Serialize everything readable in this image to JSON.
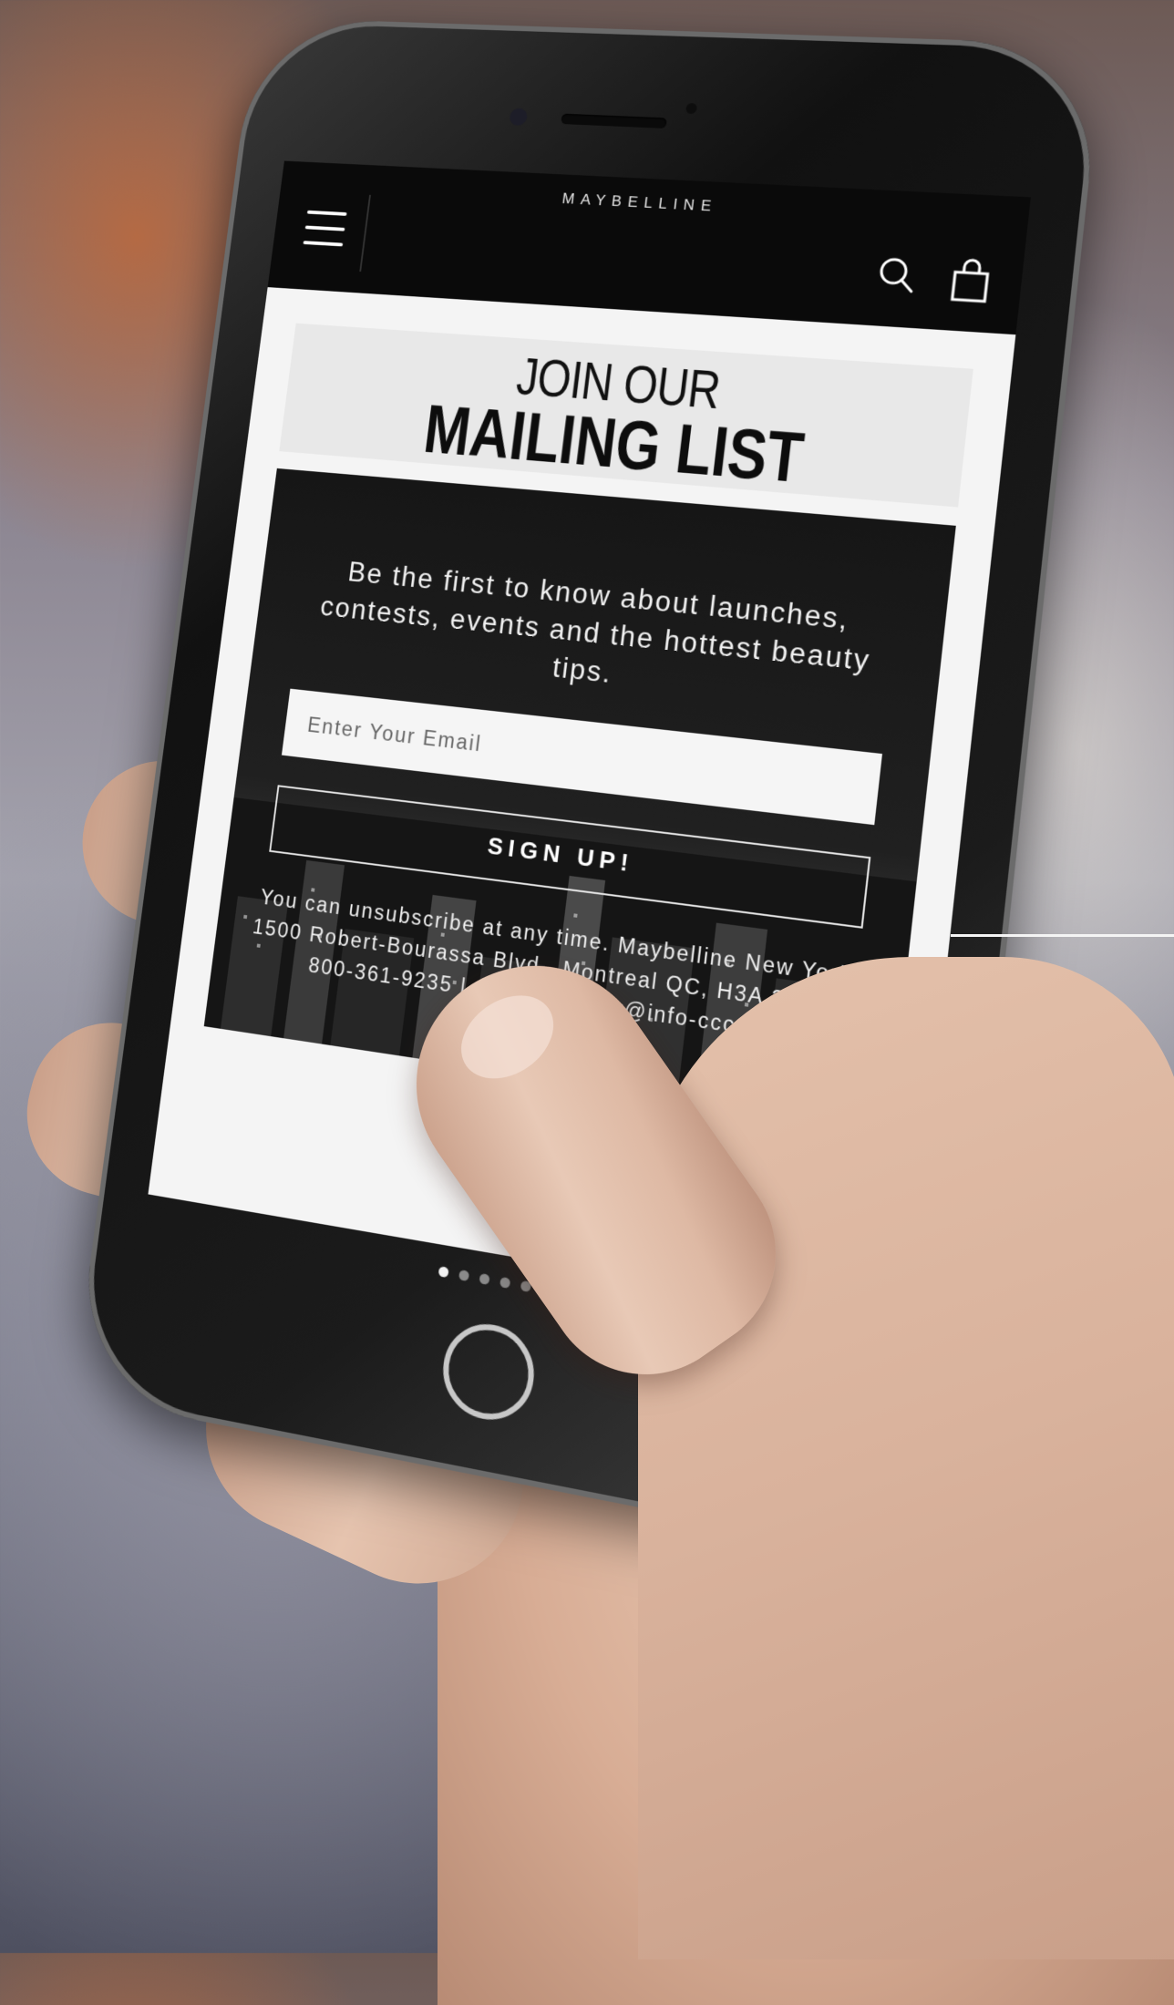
{
  "app": {
    "brand": "MAYBELLINE"
  },
  "hero": {
    "line1": "JOIN OUR",
    "line2": "MAILING LIST"
  },
  "signup_form": {
    "intro": "Be the first to know about launches, contests, events and the hottest beauty tips.",
    "email_placeholder": "Enter Your Email",
    "submit_label": "SIGN UP!",
    "legal": "You can unsubscribe at any time. Maybelline New York, 1500 Robert-Bourassa Blvd., Montreal QC, H3A 3Z1 | 1-800-361-9235 | dgcontactmny@info-ccc.com"
  },
  "carousel": {
    "page_count": 6,
    "active_page": 1
  },
  "icons": {
    "menu": "hamburger-menu-icon",
    "search": "search-icon",
    "bag": "shopping-bag-icon"
  },
  "colors": {
    "topbar": "#0a0a0a",
    "panel": "#1a1a1a",
    "screen_bg": "#f4f4f4"
  }
}
